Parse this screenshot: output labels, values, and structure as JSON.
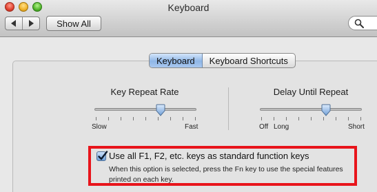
{
  "window": {
    "title": "Keyboard"
  },
  "toolbar": {
    "show_all_label": "Show All"
  },
  "tabs": [
    {
      "label": "Keyboard",
      "active": true
    },
    {
      "label": "Keyboard Shortcuts",
      "active": false
    }
  ],
  "key_repeat": {
    "title": "Key Repeat Rate",
    "min_label": "Slow",
    "max_label": "Fast",
    "level": 0.65
  },
  "delay_until_repeat": {
    "title": "Delay Until Repeat",
    "min_label": "Off",
    "mid_label": "Long",
    "max_label": "Short",
    "level": 0.65
  },
  "option": {
    "checked": true,
    "label": "Use all F1, F2, etc. keys as standard function keys",
    "help": "When this option is selected, press the Fn key to use the special features printed on each key."
  },
  "colors": {
    "highlight": "#e8141b",
    "accent": "#8fb6e6"
  },
  "icons": [
    "back-arrow-icon",
    "forward-arrow-icon",
    "magnifier-icon",
    "checkmark-icon"
  ]
}
